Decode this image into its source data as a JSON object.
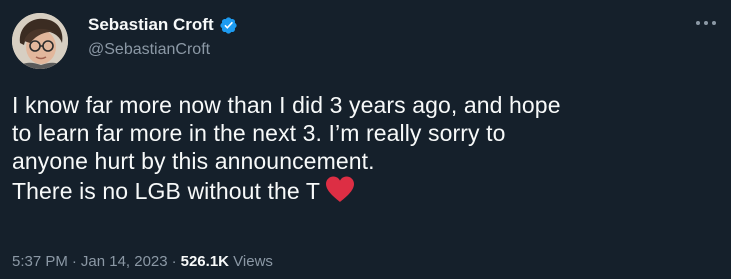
{
  "author": {
    "name": "Sebastian Croft",
    "handle": "@SebastianCroft",
    "verified": true
  },
  "tweet": {
    "lines": [
      "I know far more now than I did 3 years ago, and hope",
      "to learn far more in the next 3. I’m really sorry to",
      "anyone hurt by this announcement.",
      "There is no LGB without the T"
    ],
    "emoji": "red-heart"
  },
  "meta": {
    "time": "5:37 PM",
    "separator": "·",
    "date": "Jan 14, 2023",
    "views_count": "526.1K",
    "views_label": "Views"
  },
  "colors": {
    "background": "#15202b",
    "text": "#f7f9f9",
    "secondary_text": "#8b98a5",
    "verified": "#1d9bf0",
    "heart": "#dd2e44"
  },
  "icons": {
    "verified": "verified-badge-icon",
    "more": "more-options-icon",
    "heart": "red-heart-emoji"
  }
}
